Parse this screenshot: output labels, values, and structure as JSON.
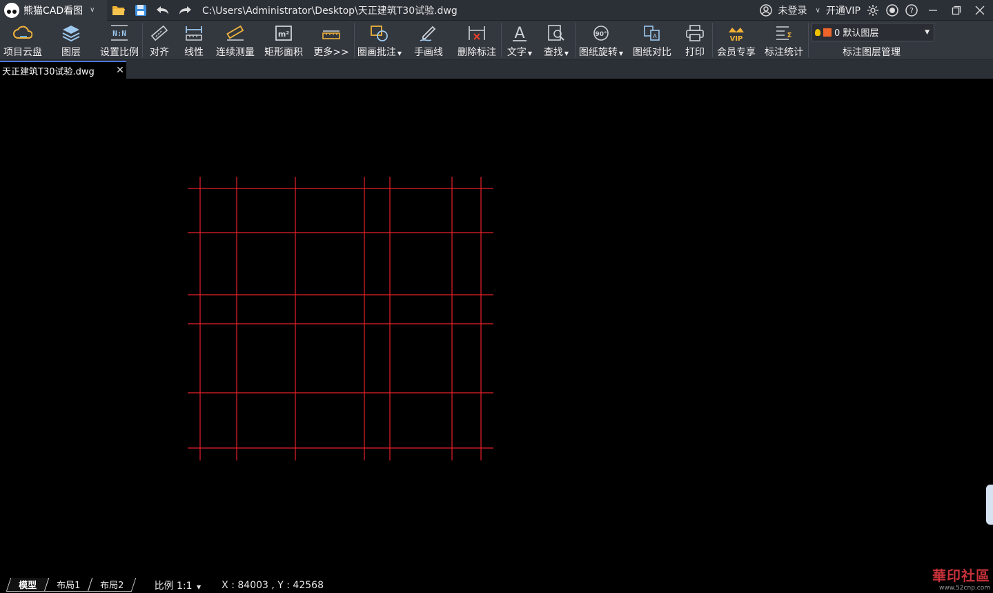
{
  "titlebar": {
    "app_name": "熊猫CAD看图",
    "file_path": "C:\\Users\\Administrator\\Desktop\\天正建筑T30试验.dwg",
    "login_label": "未登录",
    "vip_label": "开通VIP"
  },
  "toolbar": {
    "items": [
      {
        "label": "项目云盘",
        "icon": "cloud-icon"
      },
      {
        "label": "图层",
        "icon": "layers-icon"
      },
      {
        "label": "设置比例",
        "icon": "scale-icon"
      },
      {
        "label": "对齐",
        "icon": "align-ruler-icon"
      },
      {
        "label": "线性",
        "icon": "linear-dimension-icon"
      },
      {
        "label": "连续测量",
        "icon": "continuous-measure-icon"
      },
      {
        "label": "矩形面积",
        "icon": "area-icon"
      },
      {
        "label": "更多>>",
        "icon": "more-ruler-icon"
      },
      {
        "label": "圈画批注",
        "icon": "annotate-icon"
      },
      {
        "label": "手画线",
        "icon": "pen-icon"
      },
      {
        "label": "删除标注",
        "icon": "delete-dimension-icon"
      },
      {
        "label": "文字",
        "icon": "text-icon"
      },
      {
        "label": "查找",
        "icon": "find-icon"
      },
      {
        "label": "图纸旋转",
        "icon": "rotate-icon"
      },
      {
        "label": "图纸对比",
        "icon": "compare-icon"
      },
      {
        "label": "打印",
        "icon": "print-icon"
      },
      {
        "label": "会员专享",
        "icon": "vip-crown-icon"
      },
      {
        "label": "标注统计",
        "icon": "statistics-icon"
      }
    ],
    "layer_dropdown_value": "0 默认图层",
    "layer_manage_label": "标注图层管理"
  },
  "doc_tab": {
    "title": "天正建筑T30试验.dwg"
  },
  "statusbar": {
    "layout_tabs": [
      "模型",
      "布局1",
      "布局2"
    ],
    "scale_label": "比例 1:1",
    "coords": "X : 84003 , Y : 42568"
  },
  "watermark": {
    "text": "華印社區",
    "sub": "www.52cnp.com"
  },
  "colors": {
    "grid_line": "#e8202a",
    "toolbar_bg": "#33373e",
    "canvas_bg": "#000000",
    "tab_accent": "#4a78d8"
  }
}
